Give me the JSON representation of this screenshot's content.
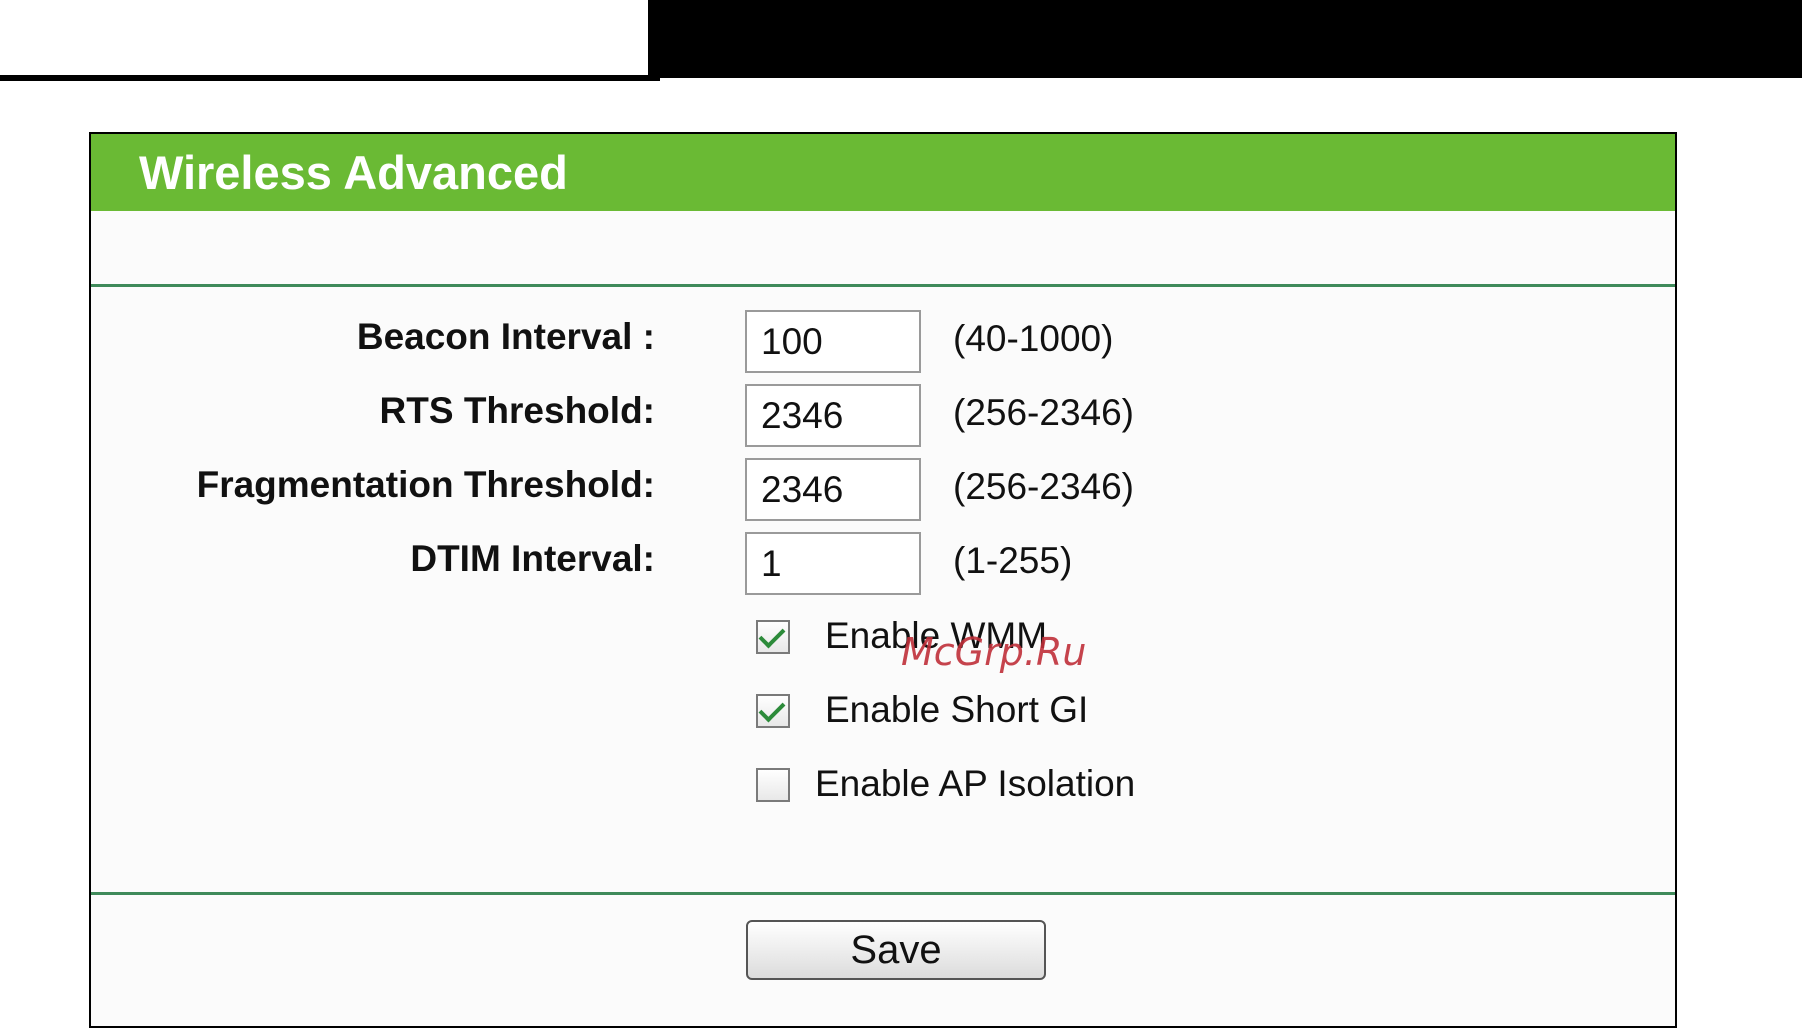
{
  "page": {
    "title": "Wireless Advanced"
  },
  "fields": [
    {
      "label": "Beacon Interval :",
      "value": "100",
      "range": "(40-1000)"
    },
    {
      "label": "RTS Threshold:",
      "value": "2346",
      "range": "(256-2346)"
    },
    {
      "label": "Fragmentation Threshold:",
      "value": "2346",
      "range": "(256-2346)"
    },
    {
      "label": "DTIM Interval:",
      "value": "1",
      "range": "(1-255)"
    }
  ],
  "checkboxes": [
    {
      "label": "Enable WMM",
      "checked": true
    },
    {
      "label": "Enable Short GI",
      "checked": true
    },
    {
      "label": "Enable AP Isolation",
      "checked": false
    }
  ],
  "actions": {
    "save_label": "Save"
  },
  "watermark": "McGrp.Ru",
  "colors": {
    "header_green": "#6aba34",
    "divider_green": "#3f8a5a",
    "check_green": "#2c8b3a"
  }
}
